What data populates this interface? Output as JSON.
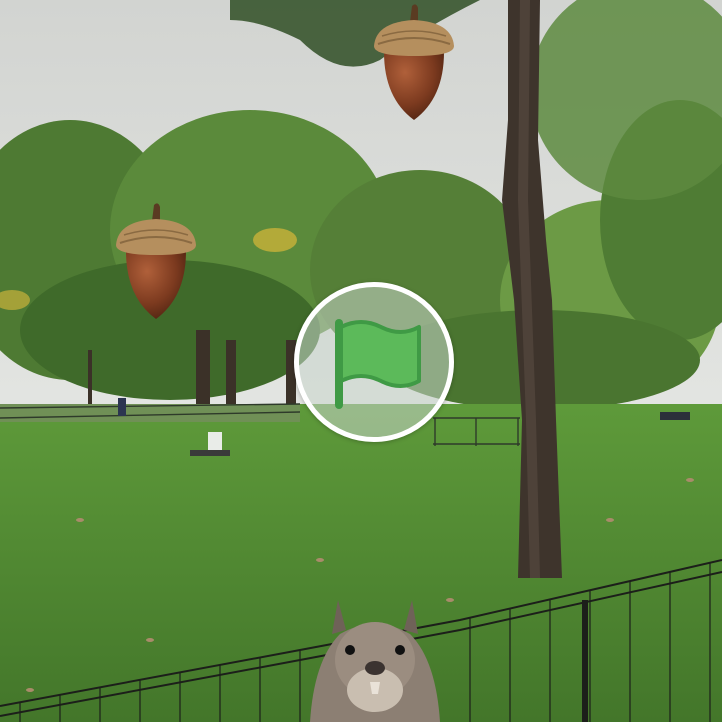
{
  "game": {
    "sprites": {
      "falling_items": [
        "acorn-icon",
        "acorn-icon"
      ],
      "player": "squirrel",
      "start_control": "green-flag-icon"
    },
    "colors": {
      "flag_green": "#5cba5a",
      "flag_outline": "#3f9a45",
      "button_ring": "#ffffff",
      "grass": "#4f8a32",
      "sky": "#d9dcd8"
    }
  }
}
